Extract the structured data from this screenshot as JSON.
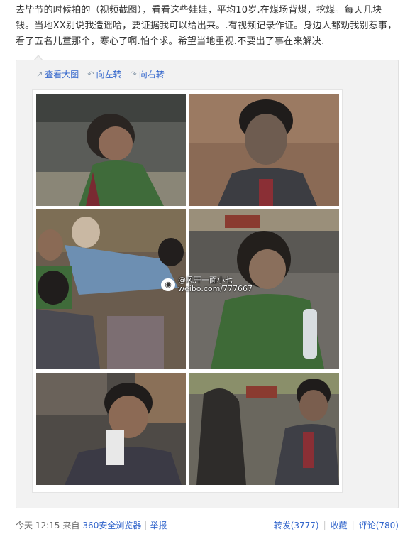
{
  "post": {
    "text": "去毕节的时候拍的（视频截图），看看这些娃娃，平均10岁.在煤场背煤，挖煤。每天几块钱。当地XX别说我造谣哈，要证据我可以给出来。.有视频记录作证。身边人都劝我别惹事，看了五名儿童那个，寒心了啊.怕个求。希望当地重视.不要出了事在来解决."
  },
  "toolbar": {
    "view_large": "查看大图",
    "rotate_left": "向左转",
    "rotate_right": "向右转",
    "view_large_icon": "external-link-icon",
    "rotate_left_icon": "rotate-left-icon",
    "rotate_right_icon": "rotate-right-icon"
  },
  "watermark": {
    "line1": "@风开一面小七",
    "line2": "weibo.com/777667"
  },
  "footer": {
    "time": "今天 12:15",
    "from_prefix": "来自",
    "source": "360安全浏览器",
    "report": "举报",
    "repost": "转发(3777)",
    "favorite": "收藏",
    "comment": "评论(780)",
    "separator": "|"
  },
  "colors": {
    "link": "#3366cc",
    "text": "#333333",
    "media_bg": "#f2f2f2"
  }
}
